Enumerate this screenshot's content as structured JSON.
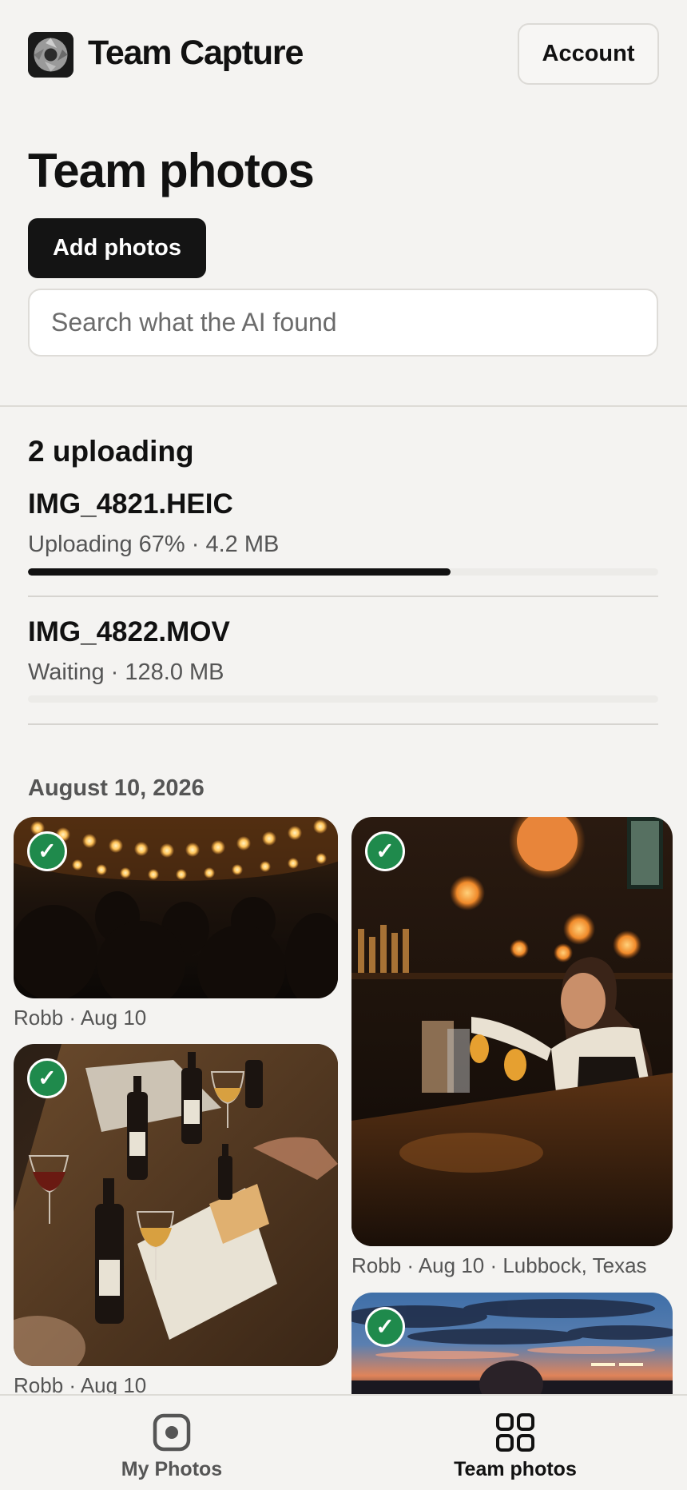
{
  "app": {
    "title": "Team Capture",
    "account_label": "Account"
  },
  "page": {
    "title": "Team photos",
    "add_label": "Add photos",
    "search_placeholder": "Search what the AI found"
  },
  "uploads": {
    "title": "2 uploading",
    "items": [
      {
        "name": "IMG_4821.HEIC",
        "status": "Uploading 67% · 4.2 MB",
        "progress": 0.67
      },
      {
        "name": "IMG_4822.MOV",
        "status": "Waiting · 128.0 MB",
        "progress": 0
      }
    ]
  },
  "gallery": {
    "date": "August 10, 2026",
    "photos": [
      {
        "caption": "Robb · Aug 10",
        "subject": "crowd under string lights",
        "checked": true
      },
      {
        "caption": "Robb · Aug 10 · Lubbock, Texas",
        "subject": "bartender pouring drinks",
        "checked": true
      },
      {
        "caption": "Robb · Aug 10",
        "subject": "wine bottles and glasses on table",
        "checked": true
      },
      {
        "caption": "",
        "subject": "sunset sky over stadium",
        "checked": true
      }
    ]
  },
  "nav": {
    "items": [
      {
        "label": "My Photos",
        "icon": "photo-circle-icon",
        "active": false
      },
      {
        "label": "Team photos",
        "icon": "grid-icon",
        "active": true
      }
    ]
  },
  "colors": {
    "accent": "#141414",
    "check": "#1f8a4c",
    "background": "#f4f3f1"
  }
}
